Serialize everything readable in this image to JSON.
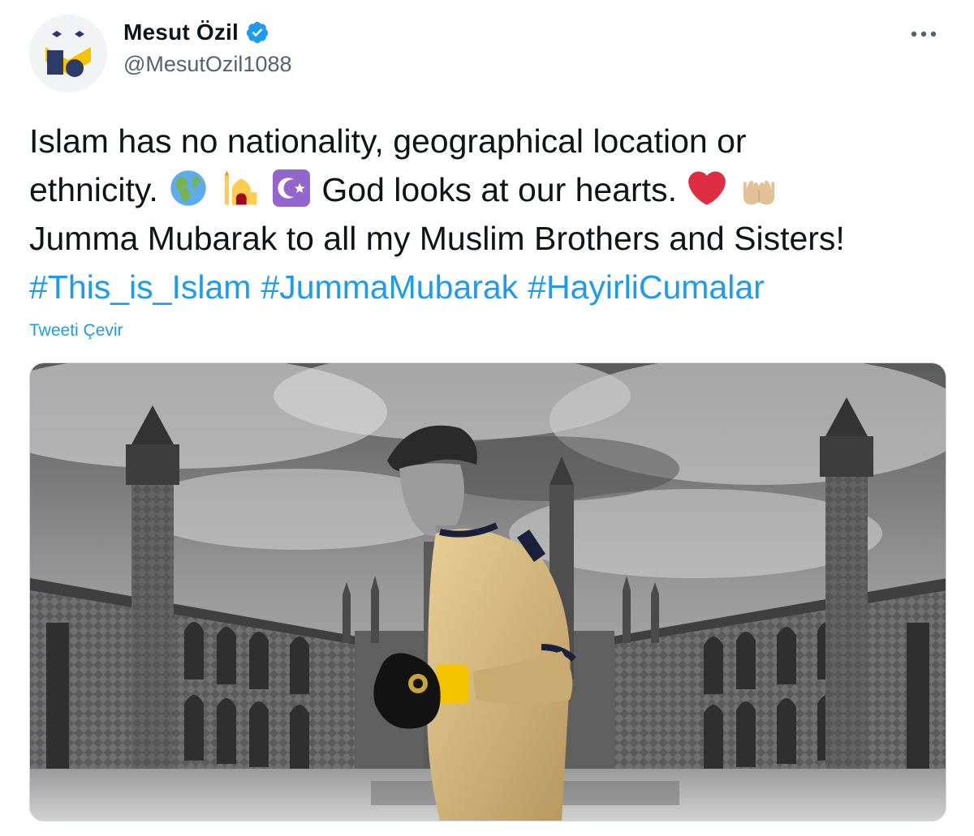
{
  "user": {
    "display_name": "Mesut Özil",
    "handle": "@MesutOzil1088",
    "verified": true,
    "avatar_icon": "m10-logo-icon"
  },
  "menu": {
    "more_icon": "more-horizontal-icon"
  },
  "tweet": {
    "line1": "Islam has no nationality, geographical location or",
    "line2_a": "ethnicity.",
    "line2_b": "God looks at our hearts.",
    "line3": "Jumma Mubarak to all my Muslim Brothers and Sisters!",
    "hashtags": [
      "#This_is_Islam",
      "#JummaMubarak",
      "#HayirliCumalar"
    ],
    "emojis": [
      "globe-americas-icon",
      "mosque-icon",
      "star-and-crescent-icon",
      "red-heart-icon",
      "palms-up-together-icon"
    ],
    "translate_label": "Tweeti Çevir"
  },
  "colors": {
    "accent": "#1d9bf0",
    "text": "#0f1419",
    "secondary": "#536471",
    "verified": "#1d9bf0"
  },
  "media": {
    "icon": "photo-mosque-player-icon"
  }
}
